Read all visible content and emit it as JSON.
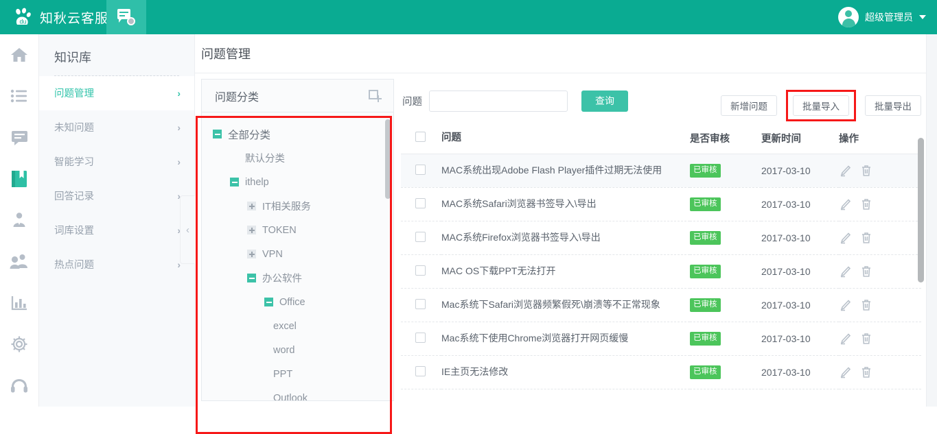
{
  "topbar": {
    "brand_title": "知秋云客服",
    "brand_logo_icon": "paw-logo-icon",
    "app_tab_icon": "chat-bubble-icon",
    "user_name": "超级管理员",
    "avatar_icon": "user-avatar-icon",
    "caret_icon": "chevron-down-icon",
    "accent_color": "#0aab92",
    "tab_active_color": "#2fbfa9"
  },
  "rail": {
    "items": [
      {
        "icon": "home-icon"
      },
      {
        "icon": "list-icon"
      },
      {
        "icon": "message-icon"
      },
      {
        "icon": "book-icon"
      },
      {
        "icon": "user-icon"
      },
      {
        "icon": "users-icon"
      },
      {
        "icon": "chart-bar-icon"
      },
      {
        "icon": "gear-icon"
      },
      {
        "icon": "headset-icon"
      }
    ],
    "active_index": 3,
    "active_color": "#3cc2a8"
  },
  "sidebar": {
    "title": "知识库",
    "items": [
      {
        "label": "问题管理",
        "active": true
      },
      {
        "label": "未知问题",
        "active": false
      },
      {
        "label": "智能学习",
        "active": false
      },
      {
        "label": "回答记录",
        "active": false
      },
      {
        "label": "词库设置",
        "active": false
      },
      {
        "label": "热点问题",
        "active": false
      }
    ],
    "chevron": "›",
    "collapse_handle_icon": "chevron-left-icon",
    "collapse_handle_glyph": "‹"
  },
  "page": {
    "title": "问题管理"
  },
  "tree_panel": {
    "title": "问题分类",
    "add_icon": "add-node-icon",
    "highlighted": true,
    "highlight_color": "#f61818",
    "nodes": [
      {
        "label": "全部分类",
        "level": 0,
        "toggle": "minus"
      },
      {
        "label": "默认分类",
        "level": 1,
        "toggle": "none"
      },
      {
        "label": "ithelp",
        "level": 1,
        "toggle": "minus"
      },
      {
        "label": "IT相关服务",
        "level": 2,
        "toggle": "plus"
      },
      {
        "label": "TOKEN",
        "level": 2,
        "toggle": "plus"
      },
      {
        "label": "VPN",
        "level": 2,
        "toggle": "plus"
      },
      {
        "label": "办公软件",
        "level": 2,
        "toggle": "minus"
      },
      {
        "label": "Office",
        "level": 3,
        "toggle": "minus"
      },
      {
        "label": "excel",
        "level": 4,
        "toggle": "none"
      },
      {
        "label": "word",
        "level": 4,
        "toggle": "none"
      },
      {
        "label": "PPT",
        "level": 4,
        "toggle": "none"
      },
      {
        "label": "Outlook",
        "level": 4,
        "toggle": "none"
      }
    ]
  },
  "toolbar": {
    "search_label": "问题",
    "search_value": "",
    "search_placeholder": "",
    "query_button": "查询",
    "new_button": "新增问题",
    "import_button": "批量导入",
    "export_button": "批量导出",
    "import_highlighted": true,
    "highlight_color": "#f61818",
    "primary_color": "#3cc2a8"
  },
  "table": {
    "headers": [
      "问题",
      "是否审核",
      "更新时间",
      "操作"
    ],
    "select_all_checked": false,
    "edit_icon": "pencil-icon",
    "delete_icon": "trash-icon",
    "badge_color": "#4cc55b",
    "rows": [
      {
        "question": "MAC系统出现Adobe Flash Player插件过期无法使用",
        "audit": "已审核",
        "time": "2017-03-10",
        "checked": false
      },
      {
        "question": "MAC系统Safari浏览器书签导入\\导出",
        "audit": "已审核",
        "time": "2017-03-10",
        "checked": false
      },
      {
        "question": "MAC系统Firefox浏览器书签导入\\导出",
        "audit": "已审核",
        "time": "2017-03-10",
        "checked": false
      },
      {
        "question": "MAC OS下载PPT无法打开",
        "audit": "已审核",
        "time": "2017-03-10",
        "checked": false
      },
      {
        "question": "Mac系统下Safari浏览器频繁假死\\崩溃等不正常现象",
        "audit": "已审核",
        "time": "2017-03-10",
        "checked": false
      },
      {
        "question": "Mac系统下使用Chrome浏览器打开网页缓慢",
        "audit": "已审核",
        "time": "2017-03-10",
        "checked": false
      },
      {
        "question": "IE主页无法修改",
        "audit": "已审核",
        "time": "2017-03-10",
        "checked": false
      }
    ]
  }
}
